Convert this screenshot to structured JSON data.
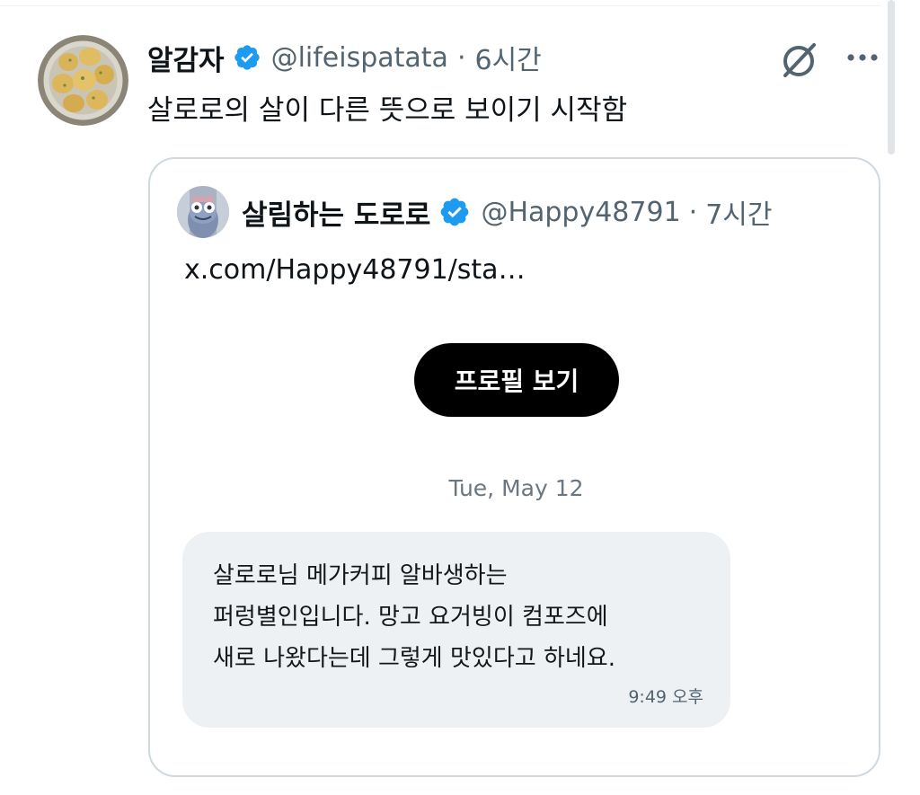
{
  "tweet": {
    "author_name": "알감자",
    "handle": "@lifeispatata",
    "separator": "·",
    "time_ago": "6시간",
    "text": "살로로의 살이 다른 뜻으로 보이기 시작함",
    "avatar_icon": "potatoes-avatar",
    "actions": {
      "grok_icon": "grok-icon",
      "more_icon": "more-icon"
    }
  },
  "quote": {
    "author_name": "살림하는 도로로",
    "handle": "@Happy48791",
    "separator": "·",
    "time_ago": "7시간",
    "link_text": "x.com/Happy48791/sta…",
    "profile_button_label": "프로필 보기",
    "avatar_icon": "frog-character-avatar",
    "message": {
      "date": "Tue, May 12",
      "lines": [
        "살로로님 메가커피 알바생하는",
        "퍼렁별인입니다. 망고 요거빙이 컴포즈에",
        "새로 나왔다는데 그렇게 맛있다고 하네요."
      ],
      "time": "9:49 오후"
    }
  },
  "colors": {
    "verified_blue": "#1d9bf0",
    "secondary_text": "#536471",
    "card_border": "#cfd9de",
    "bubble_bg": "#eef1f3",
    "button_bg": "#000000"
  }
}
